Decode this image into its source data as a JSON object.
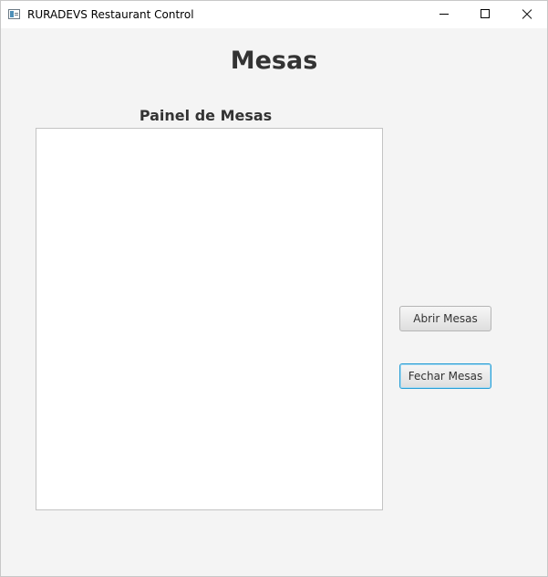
{
  "window": {
    "title": "RURADEVS Restaurant Control",
    "icon": "app-window-icon",
    "controls": {
      "minimize_icon": "minimize-icon",
      "maximize_icon": "maximize-icon",
      "close_icon": "close-icon"
    }
  },
  "main": {
    "heading": "Mesas",
    "panel_label": "Painel de Mesas"
  },
  "actions": {
    "open_label": "Abrir Mesas",
    "close_label": "Fechar Mesas"
  },
  "colors": {
    "background": "#f4f4f4",
    "panel": "#ffffff",
    "focus_border": "#2a9fd6",
    "text": "#333333"
  }
}
